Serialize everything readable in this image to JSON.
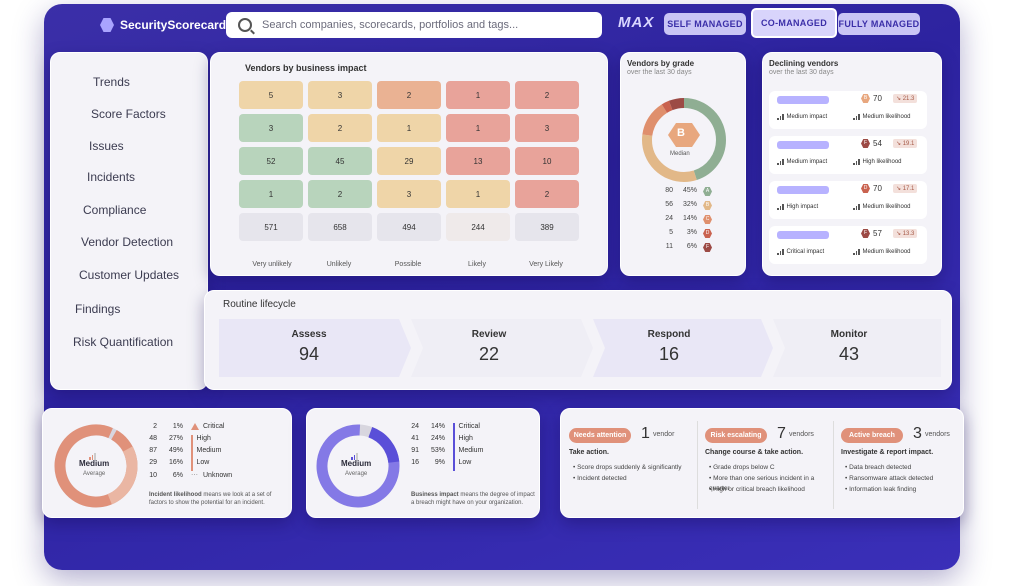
{
  "header": {
    "brand": "SecurityScorecard",
    "search_placeholder": "Search companies, scorecards, portfolios and tags...",
    "max_logo": "MAX",
    "modes": [
      "SELF MANAGED",
      "CO-MANAGED",
      "FULLY MANAGED"
    ],
    "active_mode": "CO-MANAGED"
  },
  "sidebar": {
    "items": [
      "Trends",
      "Score Factors",
      "Issues",
      "Incidents",
      "Compliance",
      "Vendor Detection",
      "Customer Updates",
      "Findings",
      "Risk Quantification"
    ]
  },
  "impact_matrix": {
    "title": "Vendors by business impact",
    "rows": [
      [
        "5",
        "3",
        "2",
        "1",
        "2"
      ],
      [
        "3",
        "2",
        "1",
        "1",
        "3"
      ],
      [
        "52",
        "45",
        "29",
        "13",
        "10"
      ],
      [
        "1",
        "2",
        "3",
        "1",
        "2"
      ],
      [
        "571",
        "658",
        "494",
        "244",
        "389"
      ]
    ],
    "columns": [
      "Very unlikely",
      "Unlikely",
      "Possible",
      "Likely",
      "Very Likely"
    ]
  },
  "grades": {
    "title": "Vendors by grade",
    "subtitle": "over the last 30 days",
    "center_grade": "B",
    "center_label": "Median",
    "rows": [
      {
        "count": "80",
        "pct": "45%",
        "grade": "A",
        "color": "#8fae93"
      },
      {
        "count": "56",
        "pct": "32%",
        "grade": "B",
        "color": "#e2b888"
      },
      {
        "count": "24",
        "pct": "14%",
        "grade": "C",
        "color": "#df8f6d"
      },
      {
        "count": "5",
        "pct": "3%",
        "grade": "D",
        "color": "#c9624f"
      },
      {
        "count": "11",
        "pct": "6%",
        "grade": "F",
        "color": "#9c4a45"
      }
    ]
  },
  "declining": {
    "title": "Declining vendors",
    "subtitle": "over the last 30 days",
    "items": [
      {
        "grade": "B",
        "score": "70",
        "change": "↘ 21.3",
        "impact": "Medium impact",
        "likelihood": "Medium likelihood"
      },
      {
        "grade": "F",
        "score": "54",
        "change": "↘ 19.1",
        "impact": "Medium impact",
        "likelihood": "High likelihood"
      },
      {
        "grade": "D",
        "score": "70",
        "change": "↘ 17.1",
        "impact": "High impact",
        "likelihood": "Medium likelihood"
      },
      {
        "grade": "F",
        "score": "57",
        "change": "↘ 13.3",
        "impact": "Critical impact",
        "likelihood": "Medium likelihood"
      }
    ]
  },
  "lifecycle": {
    "title": "Routine lifecycle",
    "steps": [
      {
        "label": "Assess",
        "value": "94"
      },
      {
        "label": "Review",
        "value": "22"
      },
      {
        "label": "Respond",
        "value": "16"
      },
      {
        "label": "Monitor",
        "value": "43"
      }
    ]
  },
  "likelihood": {
    "center": "Medium",
    "center_sub": "Average",
    "rows": [
      {
        "count": "2",
        "pct": "1%",
        "label": "Critical"
      },
      {
        "count": "48",
        "pct": "27%",
        "label": "High"
      },
      {
        "count": "87",
        "pct": "49%",
        "label": "Medium"
      },
      {
        "count": "29",
        "pct": "16%",
        "label": "Low"
      },
      {
        "count": "10",
        "pct": "6%",
        "label": "Unknown"
      }
    ],
    "note_bold": "Incident likelihood",
    "note": " means we look at a set of factors to show the potential for an incident."
  },
  "impact": {
    "center": "Medium",
    "center_sub": "Average",
    "rows": [
      {
        "count": "24",
        "pct": "14%",
        "label": "Critical"
      },
      {
        "count": "41",
        "pct": "24%",
        "label": "High"
      },
      {
        "count": "91",
        "pct": "53%",
        "label": "Medium"
      },
      {
        "count": "16",
        "pct": "9%",
        "label": "Low"
      }
    ],
    "note_bold": "Business impact",
    "note": " means the degree of impact a breach might have on your organization."
  },
  "actions": [
    {
      "pill": "Needs attention",
      "count": "1",
      "unit": "vendor",
      "title": "Take action.",
      "bullets": [
        "Score drops suddenly & significantly",
        "Incident detected"
      ]
    },
    {
      "pill": "Risk escalating",
      "count": "7",
      "unit": "vendors",
      "title": "Change course & take action.",
      "bullets": [
        "Grade drops below C",
        "More than one serious incident in a quarter",
        "High or critical breach likelihood"
      ]
    },
    {
      "pill": "Active breach",
      "count": "3",
      "unit": "vendors",
      "title": "Investigate & report impact.",
      "bullets": [
        "Data breach detected",
        "Ransomware attack detected",
        "Information leak finding"
      ]
    }
  ]
}
